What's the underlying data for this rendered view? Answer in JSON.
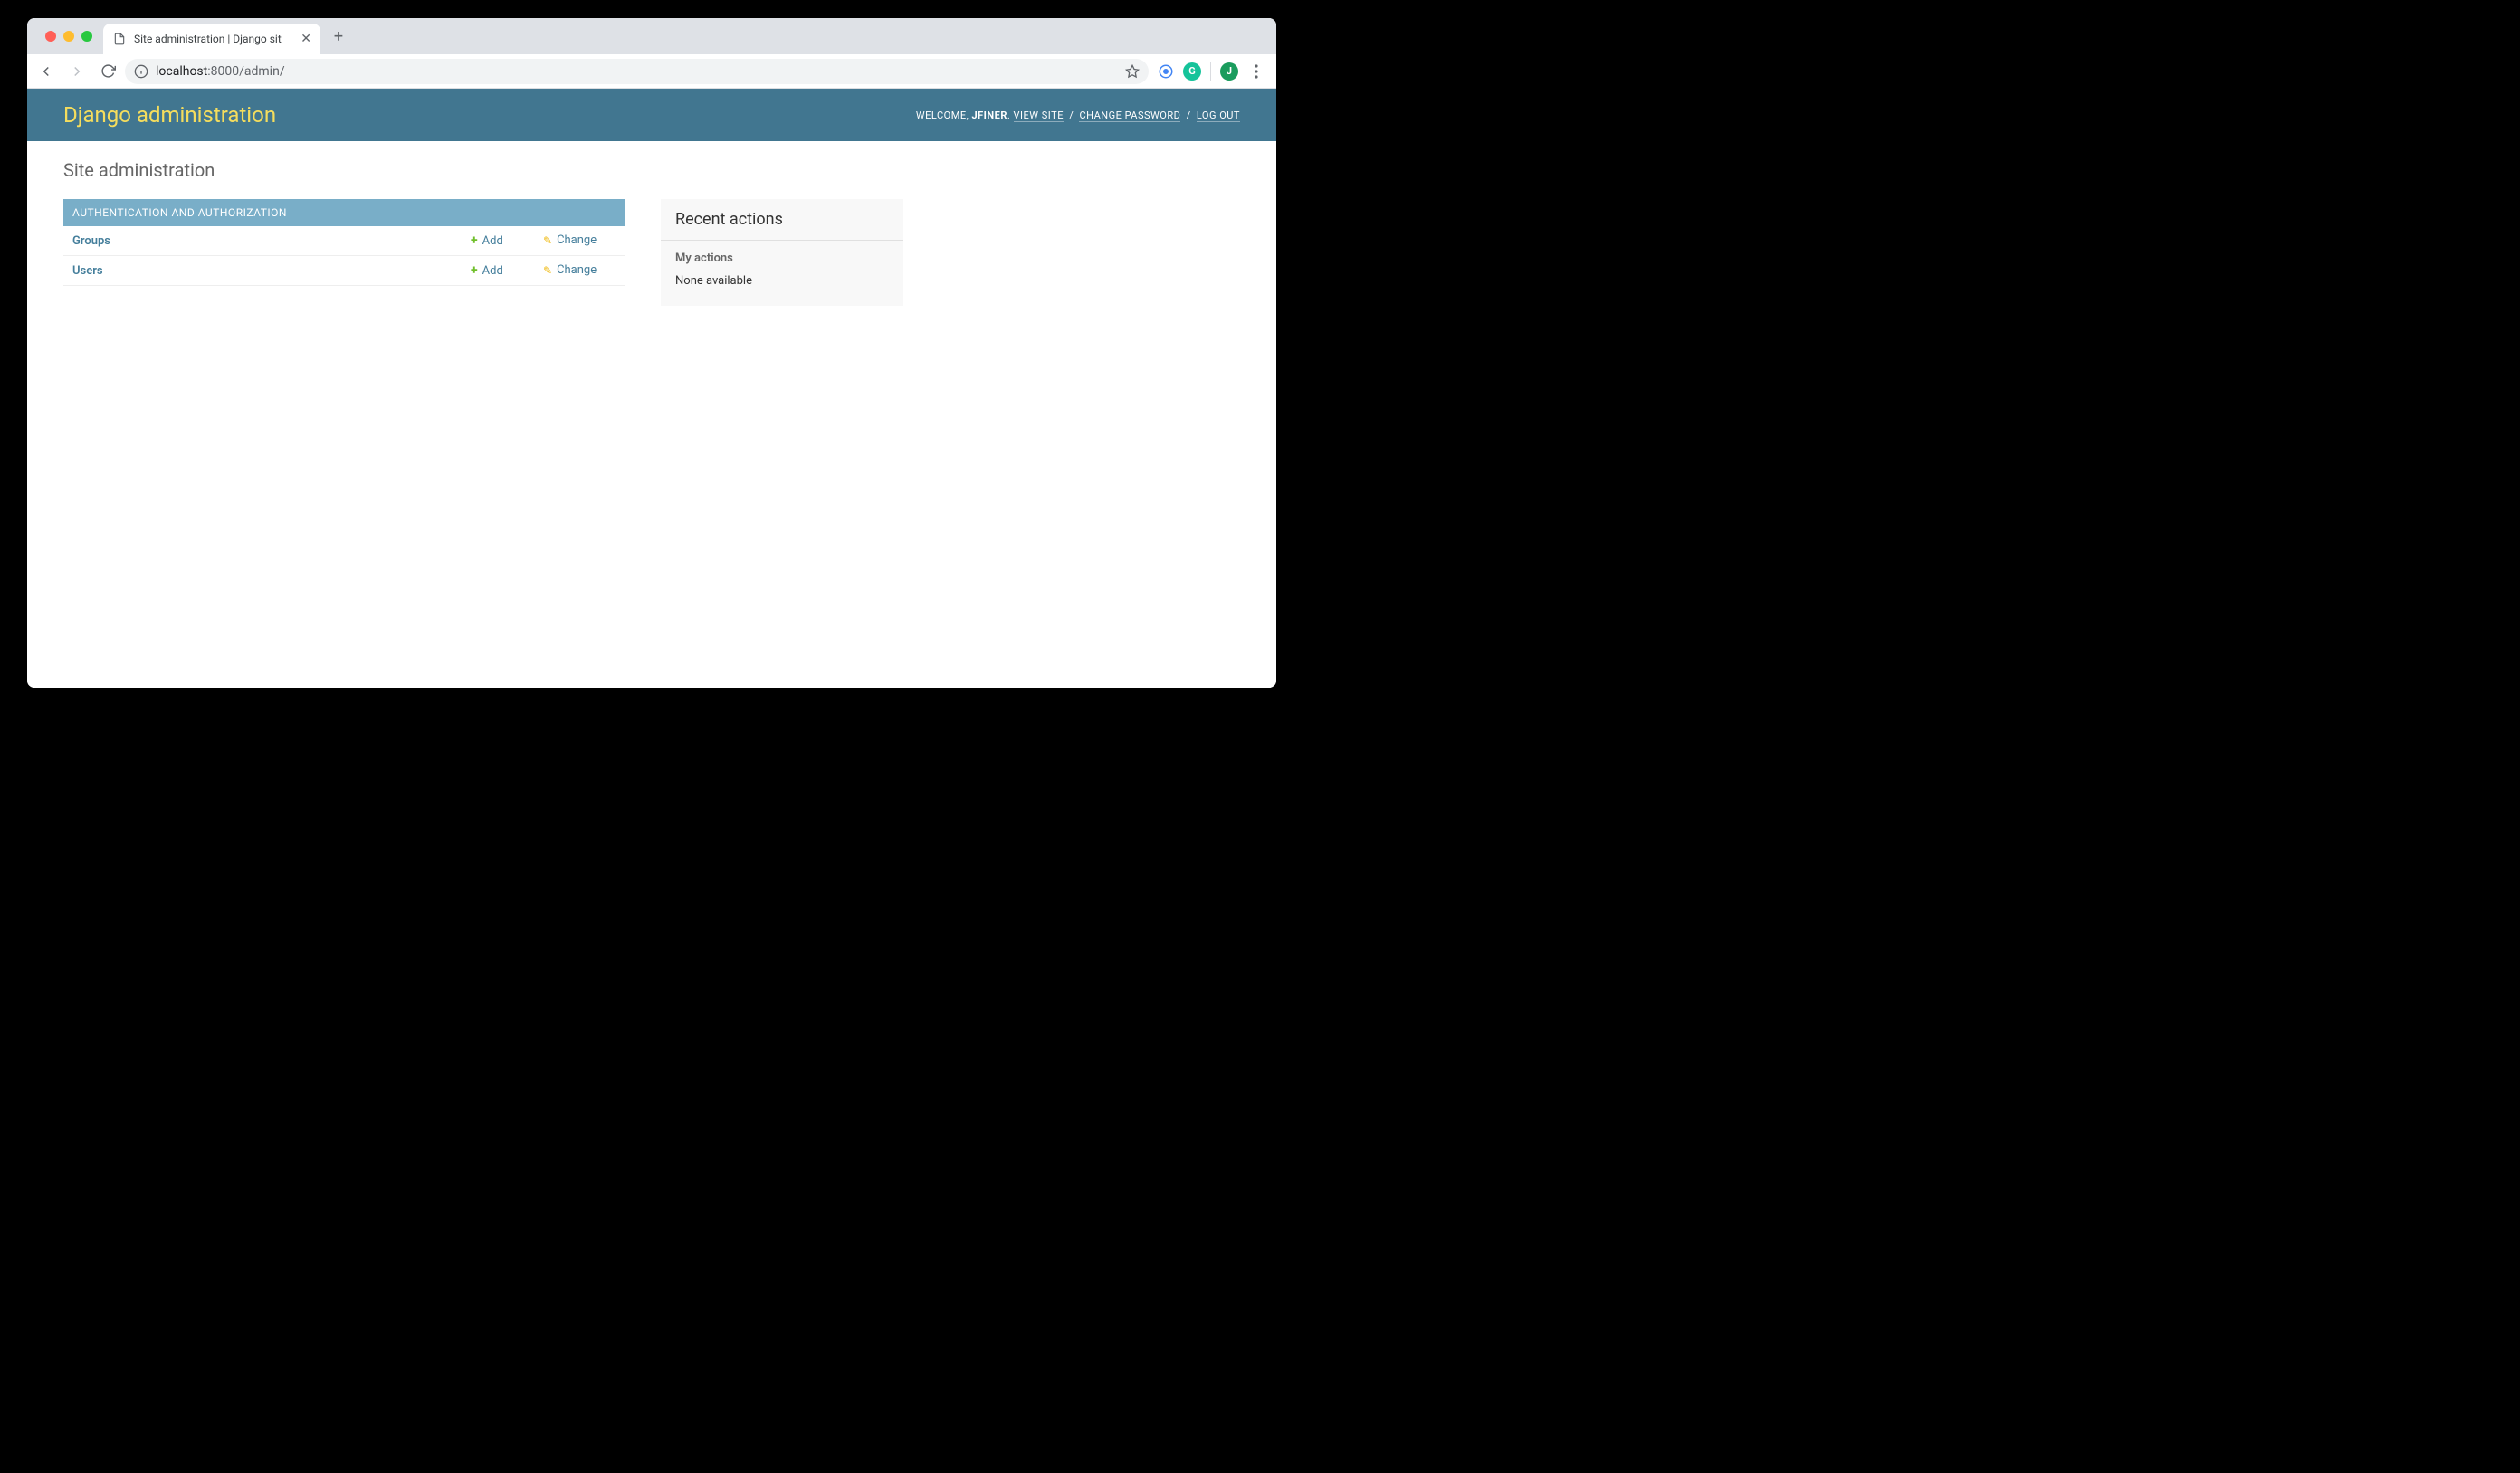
{
  "browser": {
    "tab_title": "Site administration | Django sit",
    "url_host": "localhost",
    "url_port_path": ":8000/admin/",
    "profile_initial": "J"
  },
  "header": {
    "branding": "Django administration",
    "welcome": "WELCOME, ",
    "username": "JFINER",
    "view_site": "VIEW SITE",
    "change_password": "CHANGE PASSWORD",
    "log_out": "LOG OUT"
  },
  "content": {
    "title": "Site administration"
  },
  "apps": [
    {
      "name": "AUTHENTICATION AND AUTHORIZATION",
      "models": [
        {
          "name": "Groups",
          "add_label": "Add",
          "change_label": "Change"
        },
        {
          "name": "Users",
          "add_label": "Add",
          "change_label": "Change"
        }
      ]
    }
  ],
  "recent": {
    "heading": "Recent actions",
    "subheading": "My actions",
    "empty": "None available"
  }
}
